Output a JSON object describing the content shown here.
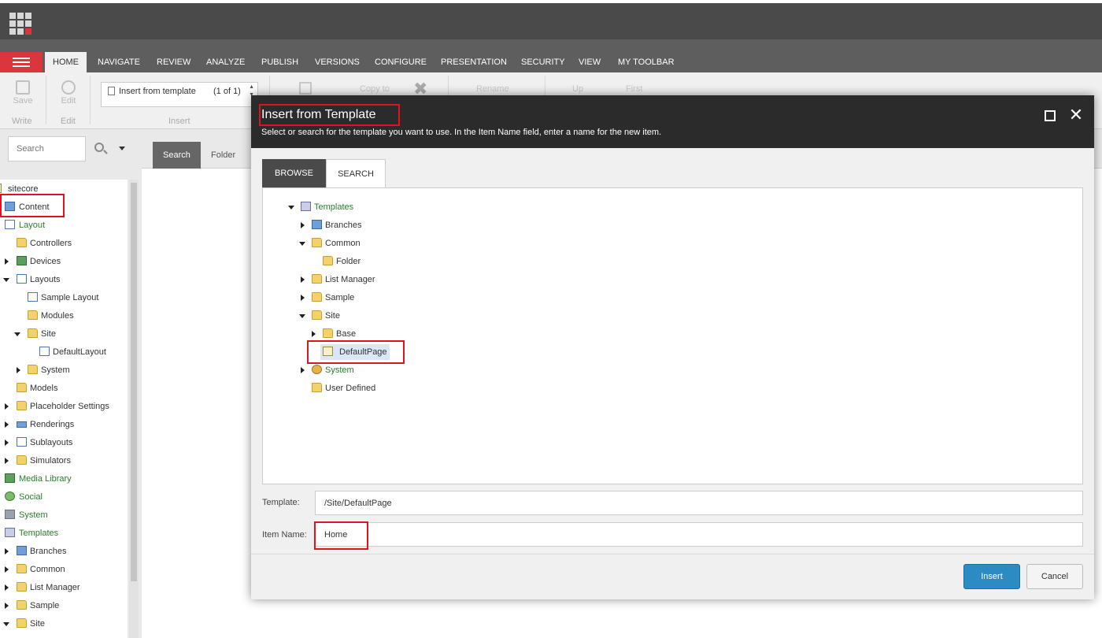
{
  "ribbon": {
    "tabs": [
      "HOME",
      "NAVIGATE",
      "REVIEW",
      "ANALYZE",
      "PUBLISH",
      "VERSIONS",
      "CONFIGURE",
      "PRESENTATION",
      "SECURITY",
      "VIEW",
      "MY TOOLBAR"
    ],
    "save_label": "Save",
    "edit_label": "Edit",
    "write_group": "Write",
    "edit_group": "Edit",
    "insert_item": "Insert from template",
    "insert_count": "(1 of 1)",
    "insert_group": "Insert",
    "copy_to": "Copy to",
    "rename": "Rename",
    "up": "Up",
    "first": "First"
  },
  "left": {
    "search_placeholder": "Search",
    "tree": [
      "sitecore",
      "Content",
      "Layout",
      "Controllers",
      "Devices",
      "Layouts",
      "Sample Layout",
      "Modules",
      "Site",
      "DefaultLayout",
      "System",
      "Models",
      "Placeholder Settings",
      "Renderings",
      "Sublayouts",
      "Simulators",
      "Media Library",
      "Social",
      "System",
      "Templates",
      "Branches",
      "Common",
      "List Manager",
      "Sample",
      "Site"
    ]
  },
  "content_tabs": [
    "Search",
    "Folder"
  ],
  "dialog": {
    "title": "Insert from Template",
    "description": "Select or search for the template you want to use. In the Item Name field, enter a name for the new item.",
    "tabs": [
      "BROWSE",
      "SEARCH"
    ],
    "tree": [
      "Templates",
      "Branches",
      "Common",
      "Folder",
      "List Manager",
      "Sample",
      "Site",
      "Base",
      "DefaultPage",
      "System",
      "User Defined"
    ],
    "template_label": "Template:",
    "template_value": "/Site/DefaultPage",
    "item_name_label": "Item Name:",
    "item_name_value": "Home",
    "insert_button": "Insert",
    "cancel_button": "Cancel"
  }
}
